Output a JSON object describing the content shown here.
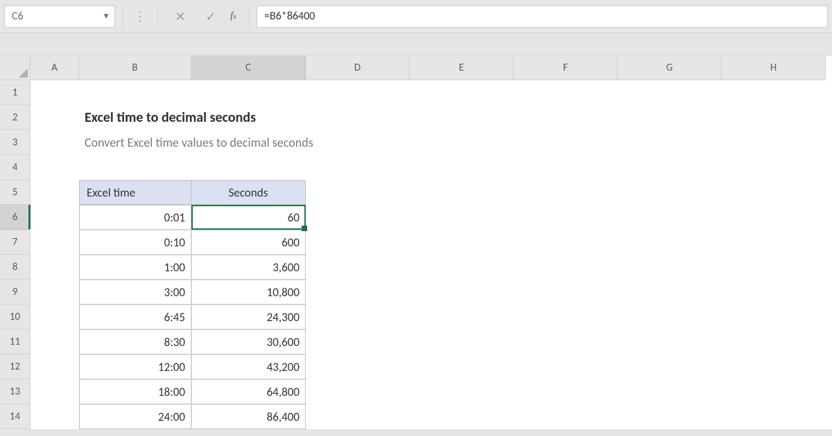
{
  "namebox": {
    "value": "C6"
  },
  "formula_bar": {
    "formula": "=B6*86400"
  },
  "columns": [
    "A",
    "B",
    "C",
    "D",
    "E",
    "F",
    "G",
    "H"
  ],
  "rows": [
    "1",
    "2",
    "3",
    "4",
    "5",
    "6",
    "7",
    "8",
    "9",
    "10",
    "11",
    "12",
    "13",
    "14"
  ],
  "content": {
    "title": "Excel time to decimal seconds",
    "subtitle": "Convert Excel time values to decimal seconds",
    "table": {
      "headers": {
        "b": "Excel time",
        "c": "Seconds"
      },
      "rows": [
        {
          "b": "0:01",
          "c": "60"
        },
        {
          "b": "0:10",
          "c": "600"
        },
        {
          "b": "1:00",
          "c": "3,600"
        },
        {
          "b": "3:00",
          "c": "10,800"
        },
        {
          "b": "6:45",
          "c": "24,300"
        },
        {
          "b": "8:30",
          "c": "30,600"
        },
        {
          "b": "12:00",
          "c": "43,200"
        },
        {
          "b": "18:00",
          "c": "64,800"
        },
        {
          "b": "24:00",
          "c": "86,400"
        }
      ]
    }
  },
  "active_cell": {
    "ref": "C6",
    "row_index": 6,
    "col_letter": "C"
  },
  "chart_data": {
    "type": "table",
    "title": "Excel time to decimal seconds",
    "columns": [
      "Excel time",
      "Seconds"
    ],
    "rows": [
      [
        "0:01",
        60
      ],
      [
        "0:10",
        600
      ],
      [
        "1:00",
        3600
      ],
      [
        "3:00",
        10800
      ],
      [
        "6:45",
        24300
      ],
      [
        "8:30",
        30600
      ],
      [
        "12:00",
        43200
      ],
      [
        "18:00",
        64800
      ],
      [
        "24:00",
        86400
      ]
    ]
  }
}
